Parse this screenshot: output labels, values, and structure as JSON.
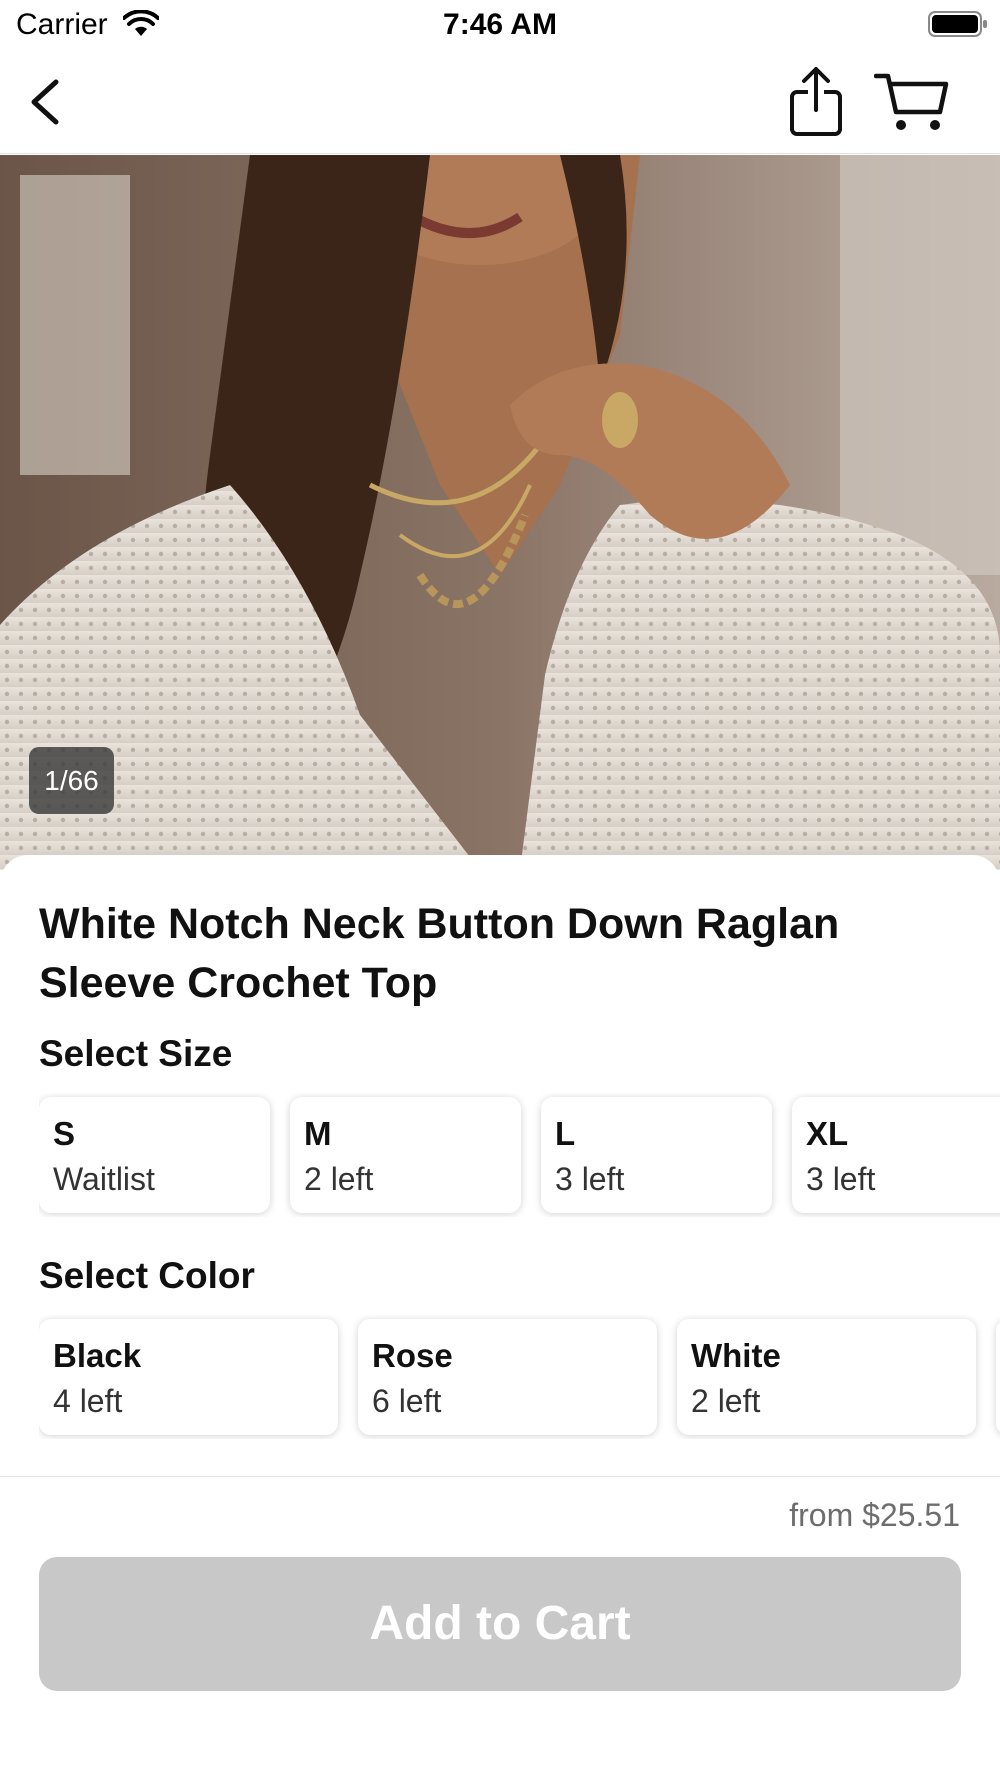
{
  "status_bar": {
    "carrier": "Carrier",
    "time": "7:46 AM"
  },
  "nav": {
    "back_icon": "chevron-left-icon",
    "share_icon": "share-icon",
    "cart_icon": "cart-icon"
  },
  "gallery": {
    "counter": "1/66"
  },
  "product": {
    "title": "White Notch Neck Button Down Raglan Sleeve Crochet Top"
  },
  "size_section": {
    "label": "Select Size",
    "options": [
      {
        "name": "S",
        "stock": "Waitlist"
      },
      {
        "name": "M",
        "stock": "2 left"
      },
      {
        "name": "L",
        "stock": "3 left"
      },
      {
        "name": "XL",
        "stock": "3 left"
      }
    ]
  },
  "color_section": {
    "label": "Select Color",
    "options": [
      {
        "name": "Black",
        "stock": "4 left"
      },
      {
        "name": "Rose",
        "stock": "6 left"
      },
      {
        "name": "White",
        "stock": "2 left"
      }
    ]
  },
  "purchase": {
    "price": "from $25.51",
    "add_to_cart_label": "Add to Cart"
  },
  "colors": {
    "button_disabled": "#c8c8c8",
    "price_text": "#6d6d6d"
  }
}
